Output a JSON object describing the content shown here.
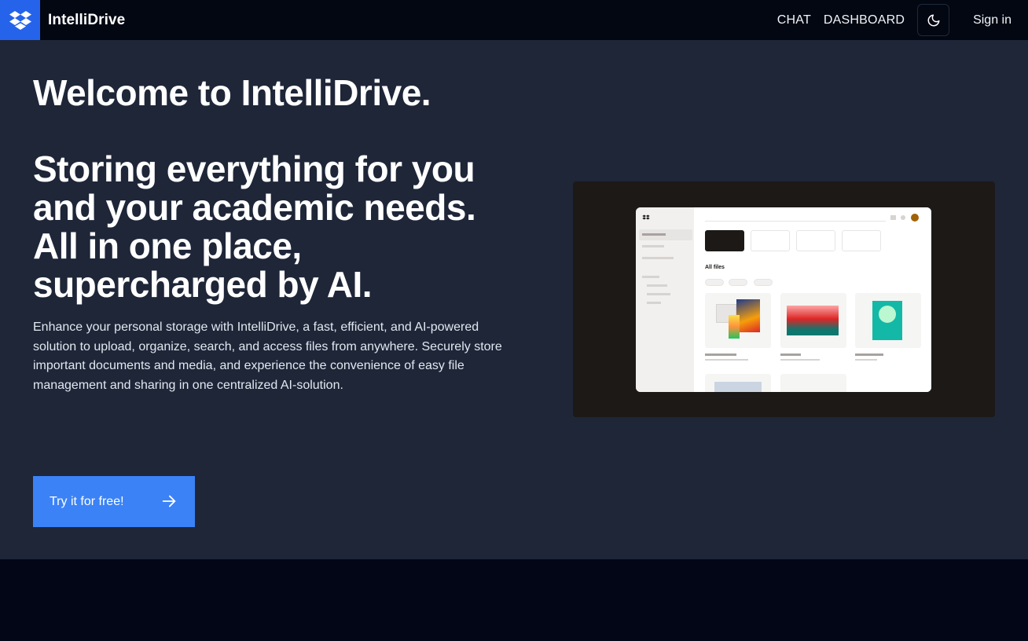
{
  "nav": {
    "brand": "IntelliDrive",
    "links": [
      "CHAT",
      "DASHBOARD"
    ],
    "theme_icon": "moon-icon",
    "signin": "Sign in"
  },
  "hero": {
    "title": "Welcome to IntelliDrive.",
    "subtitle": "Storing everything for you and your academic needs. All in one place, supercharged by AI.",
    "description": "Enhance your personal storage with IntelliDrive, a fast, efficient, and AI-powered solution to upload, organize, search, and access files from anywhere. Securely store important documents and media, and experience the convenience of easy file management and sharing in one centralized AI-solution.",
    "cta_label": "Try it for free!",
    "cta_icon": "arrow-right-icon"
  },
  "preview": {
    "section_title": "All files"
  },
  "colors": {
    "accent": "#3b82f6",
    "logo_bg": "#2563eb",
    "nav_bg": "#030712",
    "hero_bg": "#1e2638"
  }
}
